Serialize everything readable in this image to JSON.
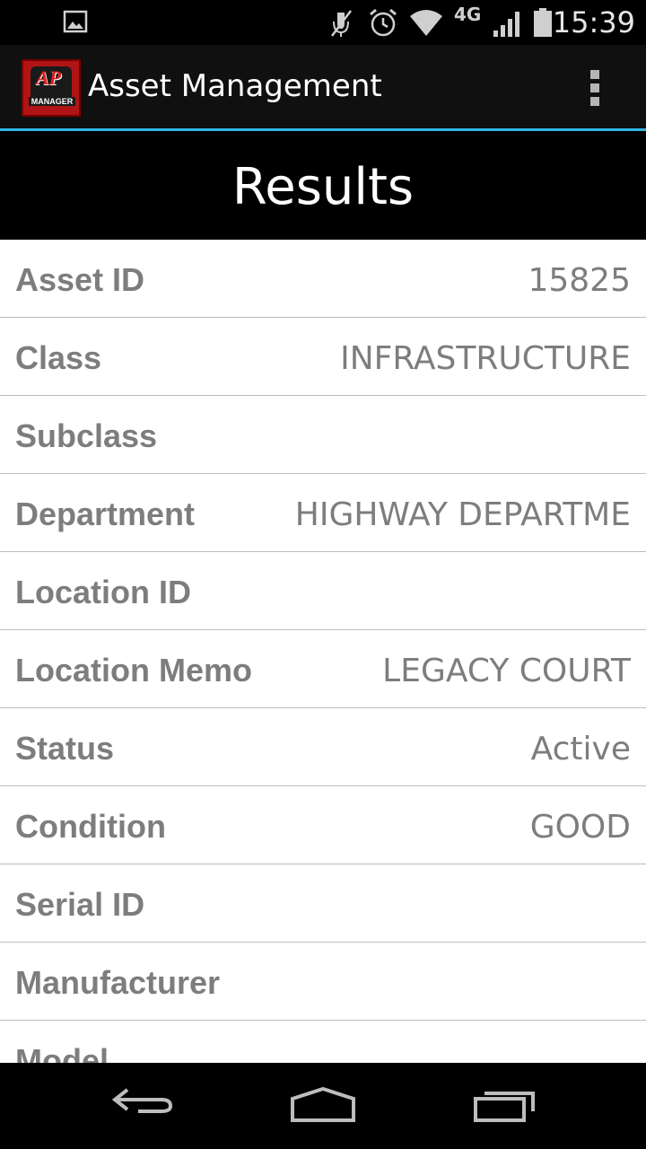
{
  "status_bar": {
    "time": "15:39",
    "network_label": "4G",
    "icons": [
      "gallery-notification-icon",
      "mute-icon",
      "alarm-icon",
      "wifi-icon",
      "network-4g-icon",
      "signal-icon",
      "battery-icon"
    ]
  },
  "action_bar": {
    "logo_mark": "AP",
    "logo_word": "MANAGER",
    "title": "Asset Management",
    "overflow_icon": "overflow-menu-icon",
    "accent_color": "#33b5e5"
  },
  "header": {
    "title": "Results"
  },
  "fields": [
    {
      "label": "Asset ID",
      "value": "15825"
    },
    {
      "label": "Class",
      "value": "INFRASTRUCTURE"
    },
    {
      "label": "Subclass",
      "value": ""
    },
    {
      "label": "Department",
      "value": "HIGHWAY DEPARTME"
    },
    {
      "label": "Location ID",
      "value": ""
    },
    {
      "label": "Location Memo",
      "value": "LEGACY COURT"
    },
    {
      "label": "Status",
      "value": "Active"
    },
    {
      "label": "Condition",
      "value": "GOOD"
    },
    {
      "label": "Serial ID",
      "value": ""
    },
    {
      "label": "Manufacturer",
      "value": ""
    },
    {
      "label": "Model",
      "value": ""
    }
  ],
  "nav_bar": {
    "icons": [
      "back-icon",
      "home-icon",
      "recent-apps-icon"
    ]
  }
}
